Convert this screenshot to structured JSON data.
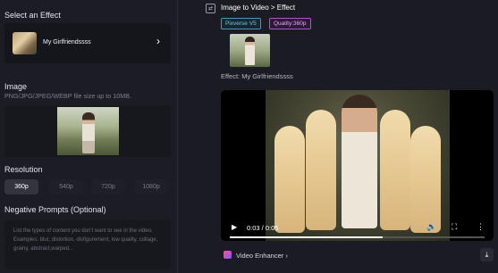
{
  "left": {
    "select_effect_title": "Select an Effect",
    "effect_name": "My Girlfriendssss",
    "chevron": "›",
    "image_title": "Image",
    "image_hint": "PNG/JPG/JPEG/WEBP file size up to 10MB.",
    "resolution_title": "Resolution",
    "resolutions": [
      "360p",
      "540p",
      "720p",
      "1080p"
    ],
    "selected_resolution": "360p",
    "negative_title": "Negative Prompts (Optional)",
    "negative_placeholder": "List the types of content you don't want to see in the video. Examples: blur, distortion, disfigurement, low quality, collage, grainy, abstract,warped..."
  },
  "right": {
    "breadcrumb_icon": "⇄",
    "breadcrumb": "Image to Video > Effect",
    "model_badge": "Pixverse V5",
    "quality_badge": "Quality:360p",
    "effect_label": "Effect: My Girlfriendssss",
    "player": {
      "play_icon": "▶",
      "time": "0:03 / 0:05",
      "progress": 0.6,
      "volume_icon": "🔊",
      "fullscreen_icon": "⛶",
      "more_icon": "⋮"
    },
    "video_enhancer": "Video Enhancer ›",
    "download_icon": "⤓"
  },
  "icons": {
    "effect_thumb": "image-thumbnail",
    "enhancer": "enhancer-icon",
    "download": "download-icon"
  },
  "colors": {
    "background": "#1b1b24",
    "model_badge": "#3f9bb8",
    "quality_badge": "#b450d8",
    "active_resolution": "#34343f"
  }
}
